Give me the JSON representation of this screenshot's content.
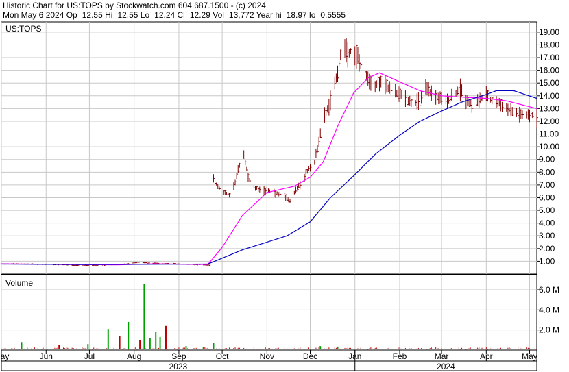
{
  "header": {
    "line1": "Historic Chart for US:TOPS by Stockwatch.com 604.687.1500 - (c) 2024",
    "line2": "Mon May  6 2024   Op=12.55   Hi=12.55   Lo=12.24   Cl=12.29   Vol=13,772   Year hi=18.97   lo=0.5555"
  },
  "colors": {
    "price_bar": "#800000",
    "ma_short": "#ff00ff",
    "ma_long": "#0000c0",
    "volume": "#c00000",
    "volume_spike": "#00a000",
    "grid": "#c8c8c8"
  },
  "chart_data": [
    {
      "type": "line",
      "title": "US:TOPS",
      "y_ticks": [
        "1.00",
        "2.00",
        "3.00",
        "4.00",
        "5.00",
        "6.00",
        "7.00",
        "8.00",
        "9.00",
        "10.00",
        "11.00",
        "12.00",
        "13.00",
        "14.00",
        "15.00",
        "16.00",
        "17.00",
        "18.00",
        "19.00"
      ],
      "ylim": [
        0,
        19.8
      ],
      "grid": true,
      "x_range": [
        "2023-05-01",
        "2024-05-06"
      ],
      "x_ticks": [
        {
          "date": "2023-05-01",
          "label": "May"
        },
        {
          "date": "2023-06-01",
          "label": "Jun"
        },
        {
          "date": "2023-07-01",
          "label": "Jul"
        },
        {
          "date": "2023-08-01",
          "label": "Aug"
        },
        {
          "date": "2023-09-01",
          "label": "Sep"
        },
        {
          "date": "2023-10-01",
          "label": "Oct"
        },
        {
          "date": "2023-11-01",
          "label": "Nov"
        },
        {
          "date": "2023-12-01",
          "label": "Dec"
        },
        {
          "date": "2024-01-01",
          "label": "Jan"
        },
        {
          "date": "2024-02-01",
          "label": "Feb"
        },
        {
          "date": "2024-03-01",
          "label": "Mar"
        },
        {
          "date": "2024-04-01",
          "label": "Apr"
        },
        {
          "date": "2024-05-01",
          "label": "May"
        }
      ],
      "year_labels": [
        {
          "label": "2023",
          "from": "2023-05-01",
          "to": "2024-01-01"
        },
        {
          "label": "2024",
          "from": "2024-01-01",
          "to": "2024-05-06"
        }
      ],
      "price_path": [
        [
          "2023-05-01",
          0.8
        ],
        [
          "2023-05-20",
          0.78
        ],
        [
          "2023-06-10",
          0.74
        ],
        [
          "2023-06-25",
          0.66
        ],
        [
          "2023-07-10",
          0.7
        ],
        [
          "2023-07-25",
          0.78
        ],
        [
          "2023-08-05",
          0.92
        ],
        [
          "2023-08-15",
          0.84
        ],
        [
          "2023-08-31",
          0.8
        ],
        [
          "2023-09-15",
          0.72
        ],
        [
          "2023-09-22",
          0.68
        ],
        [
          "2023-09-25",
          7.4
        ],
        [
          "2023-09-28",
          6.9
        ],
        [
          "2023-10-02",
          6.4
        ],
        [
          "2023-10-06",
          6.2
        ],
        [
          "2023-10-10",
          7.2
        ],
        [
          "2023-10-13",
          8.6
        ],
        [
          "2023-10-16",
          9.4
        ],
        [
          "2023-10-19",
          7.6
        ],
        [
          "2023-10-23",
          6.8
        ],
        [
          "2023-10-28",
          6.6
        ],
        [
          "2023-11-03",
          6.5
        ],
        [
          "2023-11-08",
          6.3
        ],
        [
          "2023-11-13",
          6.2
        ],
        [
          "2023-11-17",
          5.7
        ],
        [
          "2023-11-21",
          6.6
        ],
        [
          "2023-11-26",
          7.4
        ],
        [
          "2023-11-30",
          8.3
        ],
        [
          "2023-12-04",
          8.8
        ],
        [
          "2023-12-07",
          10.5
        ],
        [
          "2023-12-11",
          12.4
        ],
        [
          "2023-12-14",
          13.2
        ],
        [
          "2023-12-18",
          14.8
        ],
        [
          "2023-12-21",
          16.5
        ],
        [
          "2023-12-24",
          18.2
        ],
        [
          "2023-12-27",
          17.4
        ],
        [
          "2023-12-30",
          17.6
        ],
        [
          "2024-01-03",
          17.0
        ],
        [
          "2024-01-06",
          16.0
        ],
        [
          "2024-01-10",
          15.4
        ],
        [
          "2024-01-14",
          14.8
        ],
        [
          "2024-01-18",
          15.1
        ],
        [
          "2024-01-24",
          14.6
        ],
        [
          "2024-01-30",
          14.2
        ],
        [
          "2024-02-05",
          13.9
        ],
        [
          "2024-02-10",
          13.4
        ],
        [
          "2024-02-15",
          13.5
        ],
        [
          "2024-02-19",
          14.5
        ],
        [
          "2024-02-24",
          14.1
        ],
        [
          "2024-03-01",
          13.7
        ],
        [
          "2024-03-05",
          13.6
        ],
        [
          "2024-03-10",
          14.2
        ],
        [
          "2024-03-14",
          14.5
        ],
        [
          "2024-03-18",
          13.7
        ],
        [
          "2024-03-22",
          13.3
        ],
        [
          "2024-03-27",
          13.7
        ],
        [
          "2024-04-01",
          14.0
        ],
        [
          "2024-04-05",
          13.6
        ],
        [
          "2024-04-10",
          13.4
        ],
        [
          "2024-04-15",
          13.0
        ],
        [
          "2024-04-20",
          12.7
        ],
        [
          "2024-04-25",
          12.5
        ],
        [
          "2024-04-30",
          12.4
        ],
        [
          "2024-05-03",
          12.5
        ],
        [
          "2024-05-06",
          12.29
        ]
      ],
      "series": [
        {
          "color": "#ff00ff",
          "points": [
            [
              "2023-05-01",
              0.8
            ],
            [
              "2023-06-15",
              0.75
            ],
            [
              "2023-07-20",
              0.72
            ],
            [
              "2023-08-15",
              0.8
            ],
            [
              "2023-09-21",
              0.74
            ],
            [
              "2023-10-01",
              2.1
            ],
            [
              "2023-10-15",
              4.6
            ],
            [
              "2023-11-01",
              6.4
            ],
            [
              "2023-11-20",
              6.9
            ],
            [
              "2023-12-01",
              7.6
            ],
            [
              "2023-12-10",
              8.8
            ],
            [
              "2023-12-20",
              11.6
            ],
            [
              "2023-12-31",
              14.2
            ],
            [
              "2024-01-10",
              15.4
            ],
            [
              "2024-01-18",
              15.8
            ],
            [
              "2024-02-01",
              15.1
            ],
            [
              "2024-02-15",
              14.4
            ],
            [
              "2024-03-01",
              14.0
            ],
            [
              "2024-03-15",
              13.9
            ],
            [
              "2024-04-01",
              13.8
            ],
            [
              "2024-04-15",
              13.6
            ],
            [
              "2024-05-06",
              13.0
            ]
          ]
        },
        {
          "color": "#0000c0",
          "points": [
            [
              "2023-05-01",
              0.78
            ],
            [
              "2023-07-01",
              0.75
            ],
            [
              "2023-09-21",
              0.78
            ],
            [
              "2023-10-15",
              1.9
            ],
            [
              "2023-11-15",
              3.0
            ],
            [
              "2023-12-01",
              4.1
            ],
            [
              "2023-12-15",
              6.0
            ],
            [
              "2023-12-31",
              7.7
            ],
            [
              "2024-01-15",
              9.4
            ],
            [
              "2024-02-01",
              10.9
            ],
            [
              "2024-02-15",
              12.0
            ],
            [
              "2024-03-01",
              12.8
            ],
            [
              "2024-03-15",
              13.5
            ],
            [
              "2024-04-01",
              14.1
            ],
            [
              "2024-04-08",
              14.4
            ],
            [
              "2024-04-20",
              14.4
            ],
            [
              "2024-05-06",
              13.8
            ]
          ]
        }
      ]
    },
    {
      "type": "bar",
      "title": "Volume",
      "y_ticks": [
        "2.0 M",
        "4.0 M",
        "6.0 M"
      ],
      "ylim": [
        0,
        7.5
      ],
      "unit": "M",
      "baseline_range": [
        "2023-05-01",
        "2024-05-06"
      ],
      "spikes": [
        {
          "date": "2023-05-15",
          "value": 0.8,
          "color": "#00a000"
        },
        {
          "date": "2023-06-10",
          "value": 0.5,
          "color": "#c00000"
        },
        {
          "date": "2023-06-30",
          "value": 0.6,
          "color": "#00a000"
        },
        {
          "date": "2023-07-14",
          "value": 2.1,
          "color": "#00a000"
        },
        {
          "date": "2023-07-22",
          "value": 1.4,
          "color": "#c00000"
        },
        {
          "date": "2023-07-28",
          "value": 2.8,
          "color": "#00a000"
        },
        {
          "date": "2023-08-05",
          "value": 1.0,
          "color": "#c00000"
        },
        {
          "date": "2023-08-08",
          "value": 6.6,
          "color": "#00a000"
        },
        {
          "date": "2023-08-12",
          "value": 1.2,
          "color": "#00a000"
        },
        {
          "date": "2023-08-16",
          "value": 1.8,
          "color": "#00a000"
        },
        {
          "date": "2023-08-19",
          "value": 1.3,
          "color": "#00a000"
        },
        {
          "date": "2023-08-23",
          "value": 2.4,
          "color": "#c00000"
        },
        {
          "date": "2023-09-06",
          "value": 0.4,
          "color": "#00a000"
        },
        {
          "date": "2023-09-18",
          "value": 0.3,
          "color": "#00a000"
        },
        {
          "date": "2023-09-25",
          "value": 0.7,
          "color": "#00a000"
        },
        {
          "date": "2023-12-08",
          "value": 0.4,
          "color": "#00a000"
        },
        {
          "date": "2023-12-20",
          "value": 0.35,
          "color": "#00a000"
        }
      ]
    }
  ]
}
